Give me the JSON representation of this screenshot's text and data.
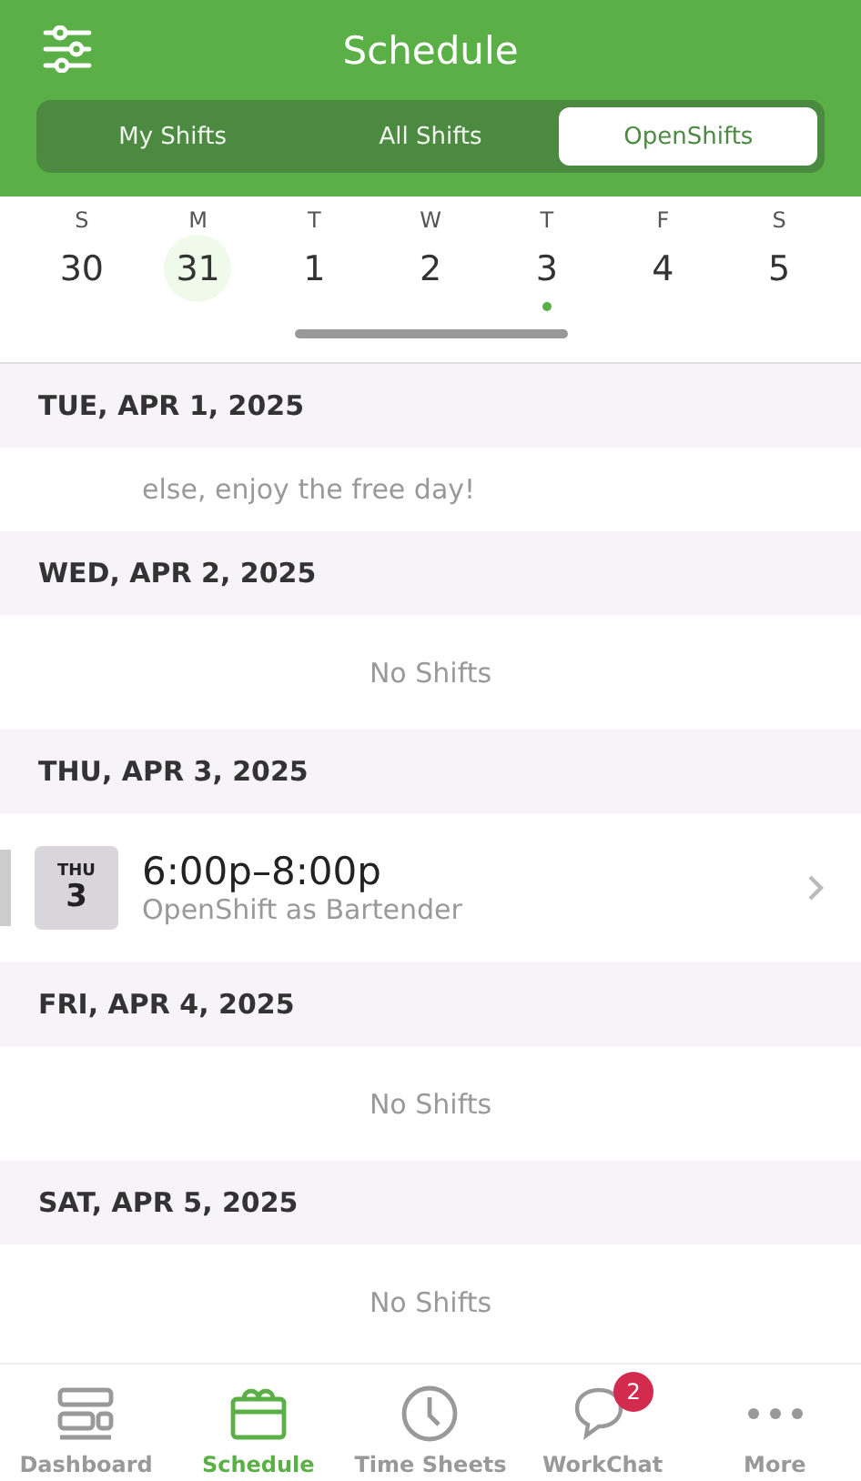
{
  "header": {
    "title": "Schedule"
  },
  "segments": [
    {
      "label": "My Shifts",
      "selected": false
    },
    {
      "label": "All Shifts",
      "selected": false
    },
    {
      "label": "OpenShifts",
      "selected": true
    }
  ],
  "week": [
    {
      "weekday": "S",
      "date": "30",
      "selected": false,
      "has_shift": false
    },
    {
      "weekday": "M",
      "date": "31",
      "selected": true,
      "has_shift": false
    },
    {
      "weekday": "T",
      "date": "1",
      "selected": false,
      "has_shift": false
    },
    {
      "weekday": "W",
      "date": "2",
      "selected": false,
      "has_shift": false
    },
    {
      "weekday": "T",
      "date": "3",
      "selected": false,
      "has_shift": true
    },
    {
      "weekday": "F",
      "date": "4",
      "selected": false,
      "has_shift": false
    },
    {
      "weekday": "S",
      "date": "5",
      "selected": false,
      "has_shift": false
    }
  ],
  "days": [
    {
      "heading": "TUE, APR 1, 2025",
      "entries": [
        {
          "kind": "message",
          "text": "else, enjoy the free day!"
        }
      ]
    },
    {
      "heading": "WED, APR 2, 2025",
      "entries": [
        {
          "kind": "empty",
          "text": "No Shifts"
        }
      ]
    },
    {
      "heading": "THU, APR 3, 2025",
      "entries": [
        {
          "kind": "shift",
          "weekday": "THU",
          "date": "3",
          "time": "6:00p–8:00p",
          "role": "OpenShift as Bartender"
        }
      ]
    },
    {
      "heading": "FRI, APR 4, 2025",
      "entries": [
        {
          "kind": "empty",
          "text": "No Shifts"
        }
      ]
    },
    {
      "heading": "SAT, APR 5, 2025",
      "entries": [
        {
          "kind": "empty",
          "text": "No Shifts"
        }
      ]
    }
  ],
  "tab_bar": [
    {
      "kind": "dashboard",
      "label": "Dashboard",
      "selected": false
    },
    {
      "kind": "schedule",
      "label": "Schedule",
      "selected": true
    },
    {
      "kind": "timesheets",
      "label": "Time Sheets",
      "selected": false
    },
    {
      "kind": "chat",
      "label": "WorkChat",
      "selected": false,
      "badge": "2"
    },
    {
      "kind": "more",
      "label": "More",
      "selected": false
    }
  ]
}
